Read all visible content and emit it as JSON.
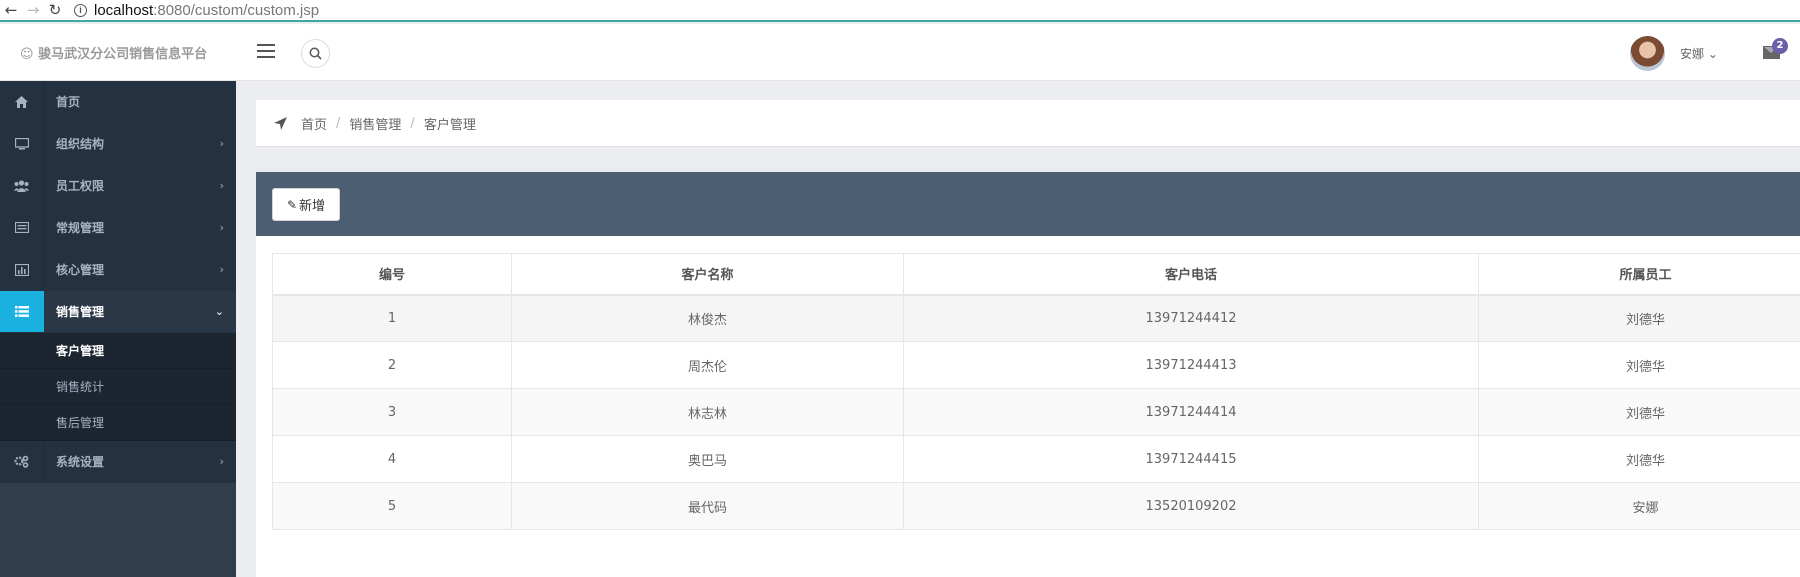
{
  "browser": {
    "url_host": "localhost",
    "url_rest": ":8080/custom/custom.jsp"
  },
  "header": {
    "brand": "☺ 骏马武汉分公司销售信息平台",
    "username": "安娜",
    "username_caret": "⌄",
    "mail_count": "2"
  },
  "sidebar": {
    "items": [
      {
        "label": "首页",
        "icon": "home-icon",
        "chev": ""
      },
      {
        "label": "组织结构",
        "icon": "desktop-icon",
        "chev": "›"
      },
      {
        "label": "员工权限",
        "icon": "users-icon",
        "chev": "›"
      },
      {
        "label": "常规管理",
        "icon": "list-alt-icon",
        "chev": "›"
      },
      {
        "label": "核心管理",
        "icon": "bar-chart-icon",
        "chev": "›"
      },
      {
        "label": "销售管理",
        "icon": "list-icon",
        "chev": "⌄"
      },
      {
        "label": "系统设置",
        "icon": "gears-icon",
        "chev": "›"
      }
    ],
    "sub_items": [
      "客户管理",
      "销售统计",
      "售后管理"
    ]
  },
  "breadcrumb": [
    "首页",
    "销售管理",
    "客户管理"
  ],
  "toolbar": {
    "add_label": "新增"
  },
  "table": {
    "headers": [
      "编号",
      "客户名称",
      "客户电话",
      "所属员工"
    ],
    "rows": [
      [
        "1",
        "林俊杰",
        "13971244412",
        "刘德华"
      ],
      [
        "2",
        "周杰伦",
        "13971244413",
        "刘德华"
      ],
      [
        "3",
        "林志林",
        "13971244414",
        "刘德华"
      ],
      [
        "4",
        "奥巴马",
        "13971244415",
        "刘德华"
      ],
      [
        "5",
        "最代码",
        "13520109202",
        "安娜"
      ]
    ]
  },
  "colors": {
    "sidebar_bg": "#2f3d4c",
    "active_icon_bg": "#1ab0e0",
    "panel_header_bg": "#4c5f72",
    "badge": "#6a5fa8"
  }
}
